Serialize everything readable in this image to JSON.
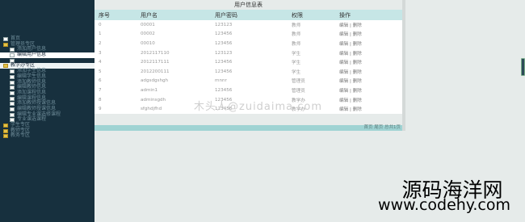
{
  "sidebar": {
    "items": [
      {
        "label": "首页",
        "icon": "page-icon",
        "selected": false
      },
      {
        "label": "管理员专区",
        "icon": "folder-icon",
        "selected": false
      },
      {
        "label": "添加用户信息",
        "icon": "page-icon",
        "selected": false
      },
      {
        "label": "编辑用户信息",
        "icon": "page-icon",
        "selected": true
      },
      {
        "label": "",
        "icon": "page-icon",
        "selected": false
      },
      {
        "label": "教学办专区",
        "icon": "folder-icon",
        "selected": "alt"
      },
      {
        "label": "添加学生信息",
        "icon": "page-icon",
        "selected": false
      },
      {
        "label": "编辑学生信息",
        "icon": "page-icon",
        "selected": false
      },
      {
        "label": "添加教师信息",
        "icon": "page-icon",
        "selected": false
      },
      {
        "label": "编辑教师信息",
        "icon": "page-icon",
        "selected": false
      },
      {
        "label": "添加课程信息",
        "icon": "page-icon",
        "selected": false
      },
      {
        "label": "编辑课程信息",
        "icon": "page-icon",
        "selected": false
      },
      {
        "label": "添加教师授课信息",
        "icon": "page-icon",
        "selected": false
      },
      {
        "label": "编辑教师授课信息",
        "icon": "page-icon",
        "selected": false
      },
      {
        "label": "编辑专业课选修课程",
        "icon": "page-icon",
        "selected": false
      },
      {
        "label": "专业课选课程",
        "icon": "page-icon",
        "selected": false
      },
      {
        "label": "学生专区",
        "icon": "folder-icon",
        "selected": false
      },
      {
        "label": "教师专区",
        "icon": "folder-icon",
        "selected": false
      },
      {
        "label": "教务专区",
        "icon": "folder-icon",
        "selected": false
      }
    ]
  },
  "main": {
    "title": "用户信息表",
    "headers": [
      "序号",
      "用户名",
      "用户密码",
      "权限",
      "操作"
    ],
    "rows": [
      [
        "0",
        "00001",
        "123123",
        "教师",
        "编辑 | 删除"
      ],
      [
        "1",
        "00002",
        "123456",
        "教师",
        "编辑 | 删除"
      ],
      [
        "2",
        "00010",
        "123456",
        "教师",
        "编辑 | 删除"
      ],
      [
        "3",
        "2012117110",
        "123123",
        "学生",
        "编辑 | 删除"
      ],
      [
        "4",
        "2012117111",
        "123456",
        "学生",
        "编辑 | 删除"
      ],
      [
        "5",
        "2012200111",
        "123456",
        "学生",
        "编辑 | 删除"
      ],
      [
        "6",
        "adgsdgshgh",
        "mnnr",
        "管理员",
        "编辑 | 删除"
      ],
      [
        "7",
        "admin1",
        "123456",
        "管理员",
        "编辑 | 删除"
      ],
      [
        "8",
        "adminsgdh",
        "123456",
        "教学办",
        "编辑 | 删除"
      ],
      [
        "9",
        "sfghdjfhd",
        "123456",
        "教学办",
        "编辑 | 删除"
      ]
    ],
    "footer": "首页 尾页 总共1页"
  },
  "watermark": "木头人@zuidaima.com",
  "brand": {
    "name": "源码海洋网",
    "url": "www.codehy.com"
  },
  "colors": {
    "sidebar_bg": "#17303e",
    "header_bg": "#c6e6e6",
    "footer_bg": "#9fd3d3",
    "page_bg": "#e6ebea"
  }
}
